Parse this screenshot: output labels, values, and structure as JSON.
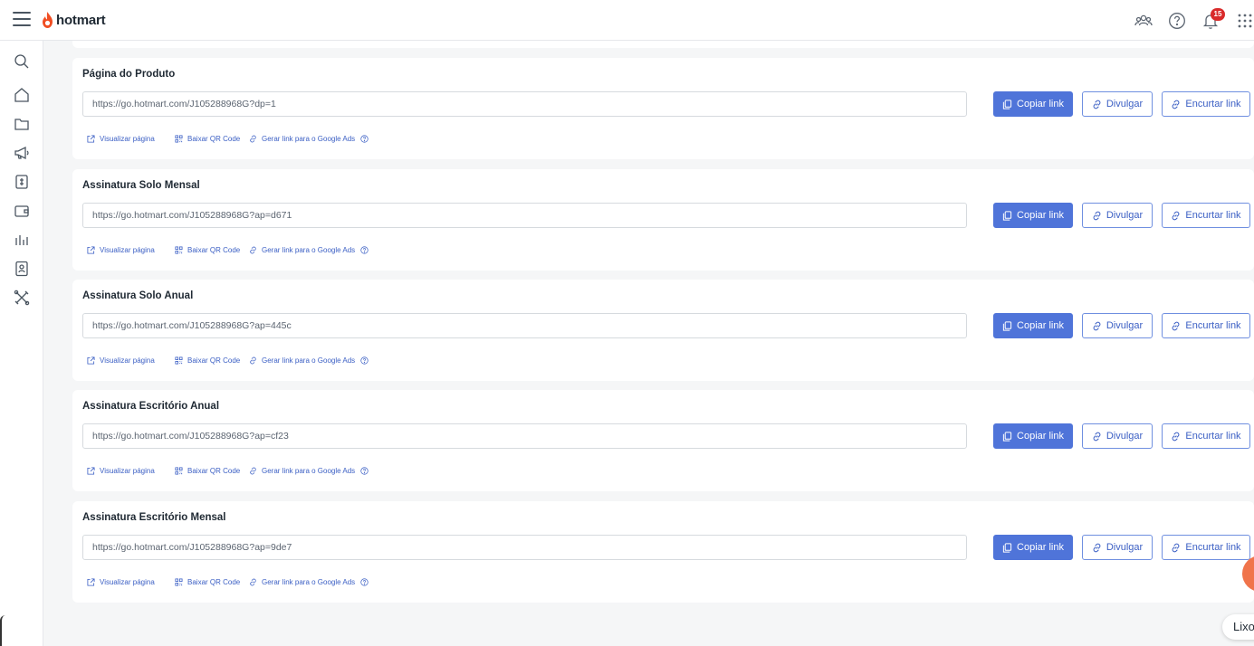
{
  "header": {
    "brand": "hotmart",
    "notifications_count": "15"
  },
  "sidebar": {
    "icons": [
      "search-icon",
      "home-icon",
      "folder-icon",
      "megaphone-icon",
      "exchange-icon",
      "wallet-icon",
      "bar-chart-icon",
      "contact-book-icon",
      "tools-icon"
    ]
  },
  "cards": [
    {
      "title": "Página do Produto",
      "url": "https://go.hotmart.com/J105288968G?dp=1"
    },
    {
      "title": "Assinatura Solo Mensal",
      "url": "https://go.hotmart.com/J105288968G?ap=d671"
    },
    {
      "title": "Assinatura Solo Anual",
      "url": "https://go.hotmart.com/J105288968G?ap=445c"
    },
    {
      "title": "Assinatura Escritório Anual",
      "url": "https://go.hotmart.com/J105288968G?ap=cf23"
    },
    {
      "title": "Assinatura Escritório Mensal",
      "url": "https://go.hotmart.com/J105288968G?ap=9de7"
    }
  ],
  "actions": {
    "copy_label": "Copiar link",
    "share_label": "Divulgar",
    "shorten_label": "Encurtar link",
    "view_label": "Visualizar página",
    "qr_label": "Baixar QR Code",
    "ads_label": "Gerar link para o Google Ads"
  },
  "floating": {
    "pill_text": "Lixo"
  },
  "colors": {
    "primary": "#4f74d9",
    "link": "#3b5fc4",
    "brand_flame": "#f04e23",
    "badge": "#d92b2b"
  }
}
